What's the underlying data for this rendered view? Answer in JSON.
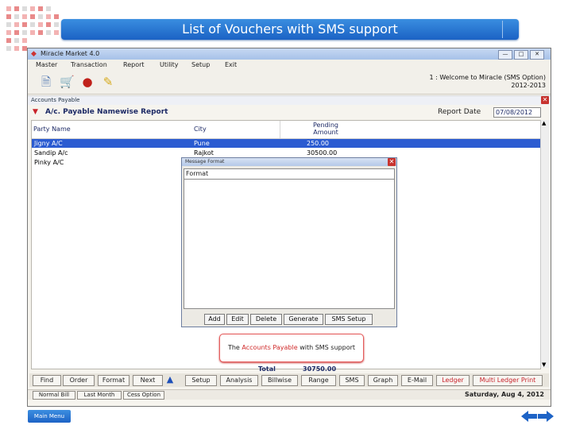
{
  "slide": {
    "title": "List of Vouchers with SMS support",
    "main_menu_label": "Main Menu",
    "accent": "#1d63c6"
  },
  "app": {
    "window_title": "Miracle Market 4.0",
    "menu": [
      "Master",
      "Transaction",
      "Report",
      "Utility",
      "Setup",
      "Exit"
    ],
    "toolbar_icons": [
      "new-document-icon",
      "cart-icon",
      "money-bag-icon",
      "edit-note-icon"
    ],
    "welcome_line1": "1 : Welcome to Miracle (SMS Option)",
    "welcome_line2": "2012-2013"
  },
  "accounts_payable": {
    "window_title": "Accounts Payable",
    "report_title": "A/c. Payable Namewise Report",
    "report_date_label": "Report Date",
    "report_date_value": "07/08/2012",
    "columns": {
      "party_name": "Party Name",
      "city": "City",
      "pending_amount_line1": "Pending",
      "pending_amount_line2": "Amount"
    },
    "rows": [
      {
        "party": "Jigny A/C",
        "city": "Pune",
        "amount": "250.00"
      },
      {
        "party": "Sandip A/c",
        "city": "Rajkot",
        "amount": "30500.00"
      },
      {
        "party": "Pinky A/C",
        "city": "",
        "amount": ""
      }
    ],
    "total_label": "Total",
    "total_value": "30750.00"
  },
  "message_format": {
    "window_title": "Message Format",
    "header": "Format",
    "buttons": [
      "Add",
      "Edit",
      "Delete",
      "Generate",
      "SMS Setup"
    ]
  },
  "callout": {
    "prefix": "The",
    "highlight": "Accounts Payable",
    "suffix": "with SMS support"
  },
  "bottom_buttons": [
    "Find",
    "Order",
    "Format",
    "Next",
    "Setup",
    "Analysis",
    "Billwise",
    "Range",
    "SMS",
    "Graph",
    "E-Mail",
    "Ledger",
    "Multi Ledger Print"
  ],
  "status": {
    "buttons": [
      "Normal Bill",
      "Last Month",
      "Cess Option"
    ],
    "date": "Saturday, Aug 4, 2012"
  }
}
